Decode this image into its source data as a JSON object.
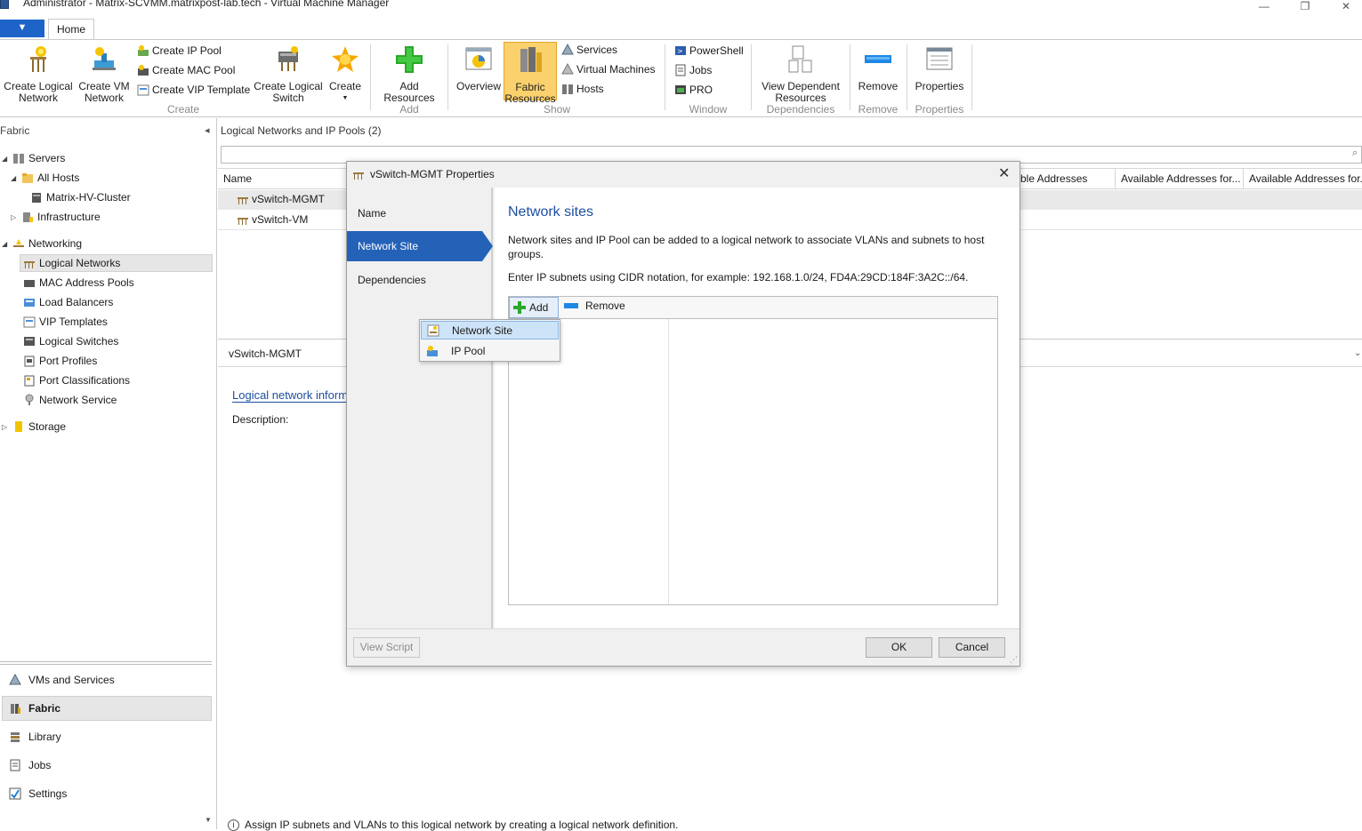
{
  "window": {
    "title": "Administrator - Matrix-SCVMM.matrixpost-lab.tech - Virtual Machine Manager",
    "minimize": "—",
    "restore": "❐",
    "close": "✕"
  },
  "ribbon": {
    "file_tab": "▼",
    "home_tab": "Home",
    "buttons": {
      "create_logical_network": "Create Logical Network",
      "create_vm_network": "Create VM Network",
      "create_ip_pool": "Create IP Pool",
      "create_mac_pool": "Create MAC Pool",
      "create_vip_template": "Create VIP Template",
      "create_logical_switch": "Create Logical Switch",
      "create": "Create",
      "add_resources": "Add Resources",
      "overview": "Overview",
      "fabric_resources": "Fabric Resources",
      "services": "Services",
      "virtual_machines": "Virtual Machines",
      "hosts": "Hosts",
      "powershell": "PowerShell",
      "jobs": "Jobs",
      "pro": "PRO",
      "view_dependent_resources": "View Dependent Resources",
      "remove": "Remove",
      "properties": "Properties"
    },
    "groups": {
      "create": "Create",
      "add": "Add",
      "show": "Show",
      "window": "Window",
      "dependencies": "Dependencies",
      "remove": "Remove",
      "properties": "Properties"
    }
  },
  "sidebar": {
    "header": "Fabric",
    "collapse": "◂",
    "tree": {
      "servers": "Servers",
      "all_hosts": "All Hosts",
      "cluster": "Matrix-HV-Cluster",
      "infrastructure": "Infrastructure",
      "networking": "Networking",
      "logical_networks": "Logical Networks",
      "mac_address_pools": "MAC Address Pools",
      "load_balancers": "Load Balancers",
      "vip_templates": "VIP Templates",
      "logical_switches": "Logical Switches",
      "port_profiles": "Port Profiles",
      "port_classifications": "Port Classifications",
      "network_service": "Network Service",
      "storage": "Storage"
    },
    "workspaces": {
      "vms_and_services": "VMs and Services",
      "fabric": "Fabric",
      "library": "Library",
      "jobs": "Jobs",
      "settings": "Settings"
    }
  },
  "main": {
    "header": "Logical Networks and IP Pools (2)",
    "columns": {
      "name": "Name",
      "col2": "ble Addresses",
      "col3": "Available Addresses for...",
      "col4": "Available Addresses for..."
    },
    "rows": [
      "vSwitch-MGMT",
      "vSwitch-VM"
    ],
    "detail_title": "vSwitch-MGMT",
    "detail_link": "Logical network inform",
    "description_label": "Description:",
    "bottom_info": "Assign IP subnets and VLANs to this logical network by creating a logical network definition."
  },
  "dialog": {
    "title": "vSwitch-MGMT Properties",
    "close": "✕",
    "nav": {
      "name": "Name",
      "network_site": "Network Site",
      "dependencies": "Dependencies"
    },
    "heading": "Network sites",
    "description": "Network sites and IP Pool can be added to a logical network to associate VLANs and subnets to host groups.",
    "cidr_hint": "Enter IP subnets using CIDR notation, for example: 192.168.1.0/24, FD4A:29CD:184F:3A2C::/64.",
    "add": "Add",
    "remove": "Remove",
    "dropdown": {
      "network_site": "Network Site",
      "ip_pool": "IP Pool"
    },
    "view_script": "View Script",
    "ok": "OK",
    "cancel": "Cancel"
  },
  "colors": {
    "accent": "#2462b8",
    "heading": "#1e4fa0"
  }
}
